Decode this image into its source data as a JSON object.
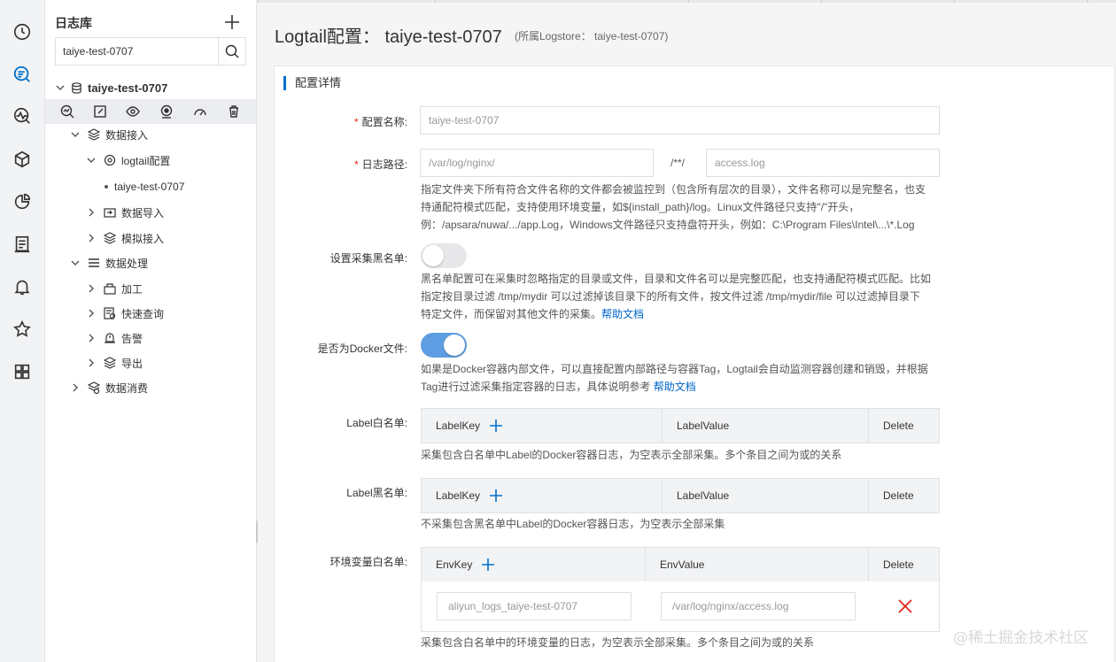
{
  "rail": {
    "icons": [
      "clock-icon",
      "log-search-icon",
      "monitor-icon",
      "cube-icon",
      "pie-chart-icon",
      "report-icon",
      "bell-icon",
      "star-icon",
      "grid-icon"
    ]
  },
  "tree": {
    "title": "日志库",
    "search_value": "taiye-test-0707",
    "root_label": "taiye-test-0707",
    "toolbar_icons": [
      "query-icon",
      "edit-icon",
      "eye-icon",
      "location-icon",
      "gauge-icon",
      "trash-icon"
    ],
    "nodes": {
      "data_ingest": "数据接入",
      "logtail_config": "logtail配置",
      "logtail_item": "taiye-test-0707",
      "data_import": "数据导入",
      "simulate": "模拟接入",
      "data_process": "数据处理",
      "process": "加工",
      "quick_query": "快速查询",
      "alert": "告警",
      "export": "导出",
      "data_consume": "数据消费"
    }
  },
  "header": {
    "title": "Logtail配置：  taiye-test-0707",
    "subtitle": "(所属Logstore：  taiye-test-0707)"
  },
  "section": {
    "title": "配置详情"
  },
  "form": {
    "config_name": {
      "label": "配置名称:",
      "value": "taiye-test-0707"
    },
    "log_path": {
      "label": "日志路径:",
      "dir_value": "/var/log/nginx/",
      "sep": "/**/",
      "file_value": "access.log",
      "help": [
        "指定文件夹下所有符合文件名称的文件都会被监控到（包含所有层次的目录），文件名称可以是完整名，也支",
        "持通配符模式匹配，支持使用环境变量，如${install_path}/log。Linux文件路径只支持\"/\"开头，",
        "例：/apsara/nuwa/.../app.Log，Windows文件路径只支持盘符开头，例如：C:\\Program Files\\Intel\\...\\*.Log"
      ]
    },
    "blacklist": {
      "label": "设置采集黑名单:",
      "enabled": false,
      "help": [
        "黑名单配置可在采集时忽略指定的目录或文件，目录和文件名可以是完整匹配，也支持通配符模式匹配。比如",
        "指定按目录过滤 /tmp/mydir 可以过滤掉该目录下的所有文件，按文件过滤 /tmp/mydir/file 可以过滤掉目录下",
        "特定文件，而保留对其他文件的采集。"
      ],
      "help_link": "帮助文档"
    },
    "docker": {
      "label": "是否为Docker文件:",
      "enabled": true,
      "help": [
        "如果是Docker容器内部文件，可以直接配置内部路径与容器Tag，Logtail会自动监测容器创建和销毁，并根据",
        "Tag进行过滤采集指定容器的日志，具体说明参考 "
      ],
      "help_link": "帮助文档"
    },
    "label_whitelist": {
      "label": "Label白名单:",
      "col_key": "LabelKey",
      "col_value": "LabelValue",
      "col_delete": "Delete",
      "help": "采集包含白名单中Label的Docker容器日志，为空表示全部采集。多个条目之间为或的关系"
    },
    "label_blacklist": {
      "label": "Label黑名单:",
      "col_key": "LabelKey",
      "col_value": "LabelValue",
      "col_delete": "Delete",
      "help": "不采集包含黑名单中Label的Docker容器日志，为空表示全部采集"
    },
    "env_whitelist": {
      "label": "环境变量白名单:",
      "col_key": "EnvKey",
      "col_value": "EnvValue",
      "col_delete": "Delete",
      "row_key_placeholder": "aliyun_logs_taiye-test-0707",
      "row_value_placeholder": "/var/log/nginx/access.log",
      "help": "采集包含白名单中的环境变量的日志，为空表示全部采集。多个条目之间为或的关系"
    }
  },
  "watermark": "@稀土掘金技术社区",
  "colors": {
    "accent": "#0070cc",
    "required": "#e3261d",
    "toggle_on": "#5e9de1",
    "delete_x": "#e3261d"
  }
}
